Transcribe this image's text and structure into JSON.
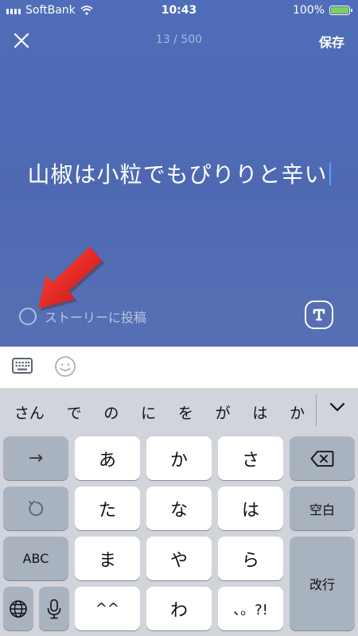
{
  "status_bar": {
    "carrier": "SoftBank",
    "time": "10:43",
    "battery": "100%"
  },
  "header": {
    "counter": "13 / 500",
    "save_label": "保存"
  },
  "post": {
    "text": "山椒は小粒でもぴりりと辛い"
  },
  "story_toggle": {
    "label": "ストーリーに投稿"
  },
  "candidates": [
    "さん",
    "で",
    "の",
    "に",
    "を",
    "が",
    "は",
    "か"
  ],
  "keyboard": {
    "row1": {
      "left": "→",
      "k1": "あ",
      "k2": "か",
      "k3": "さ"
    },
    "row2": {
      "k1": "た",
      "k2": "な",
      "k3": "は",
      "right": "空白"
    },
    "row3": {
      "left": "ABC",
      "k1": "ま",
      "k2": "や",
      "k3": "ら"
    },
    "row4": {
      "k1": "^^",
      "k2": "わ",
      "k3": "、。?!"
    },
    "enter": "改行"
  },
  "colors": {
    "background_top": "#4f6db8",
    "caret": "#4aa7ff",
    "arrow": "#e8191b"
  }
}
